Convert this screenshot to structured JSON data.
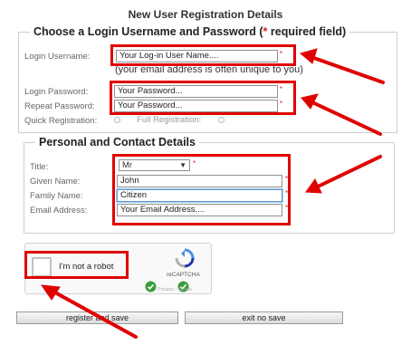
{
  "page": {
    "title": "New User Registration Details"
  },
  "login_section": {
    "legend_prefix": "Choose a Login Username and Password (",
    "legend_star": "*",
    "legend_suffix": " required field)",
    "username_label": "Login Username:",
    "username_value": "Your Log-in User Name....",
    "username_note": "(your email address is often unique to you)",
    "password_label": "Login Password:",
    "password_value": "Your Password...",
    "repeat_label": "Repeat Password:",
    "repeat_value": "Your Password...",
    "quick_label": "Quick Registration:",
    "full_label": "Full Registration:",
    "required_mark": "*"
  },
  "personal_section": {
    "legend": "Personal and Contact Details",
    "title_label": "Title:",
    "title_value": "Mr",
    "given_label": "Given Name:",
    "given_value": "John",
    "family_label": "Family Name:",
    "family_value": "Citizen",
    "email_label": "Email Address:",
    "email_value": "Your Email Address....",
    "required_mark": "*"
  },
  "captcha": {
    "label": "I'm not a robot",
    "brand": "reCAPTCHA",
    "links": "Privacy - Terms"
  },
  "buttons": {
    "register": "register and save",
    "exit": "exit no save"
  },
  "colors": {
    "annotation_red": "#e00000",
    "required_red": "#e02020",
    "focus_blue": "#5b9bd5"
  }
}
